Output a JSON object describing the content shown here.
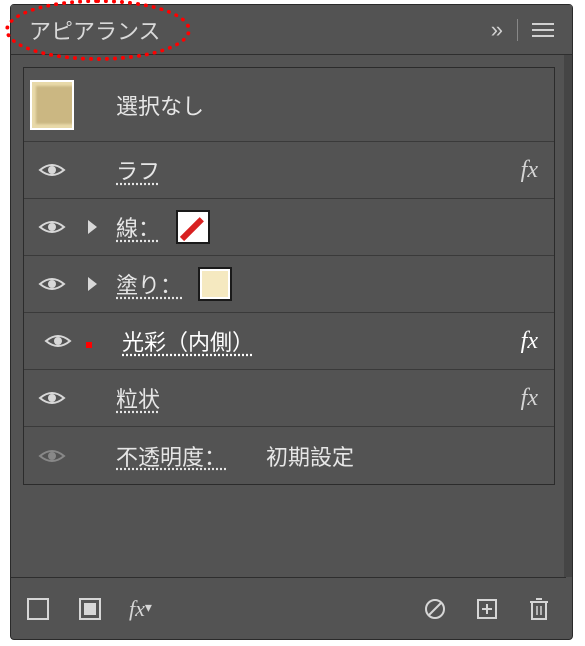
{
  "panel": {
    "title": "アピアランス",
    "collapse_label": "»"
  },
  "selection": {
    "label": "選択なし"
  },
  "rows": [
    {
      "label": "ラフ",
      "has_fx": true
    },
    {
      "label": "線：",
      "has_expand": true,
      "swatch": "stroke"
    },
    {
      "label": "塗り：",
      "has_expand": true,
      "swatch": "fill"
    },
    {
      "label": "光彩（内側）",
      "has_fx": true,
      "selected": true
    },
    {
      "label": "粒状",
      "has_fx": true
    },
    {
      "label": "不透明度：",
      "value": "初期設定",
      "dim_eye": true
    }
  ],
  "fx_glyph": "fx"
}
